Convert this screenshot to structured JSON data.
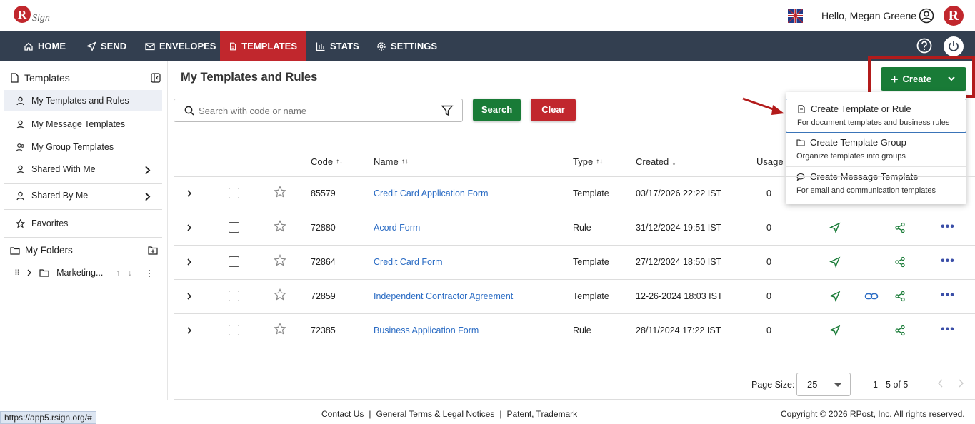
{
  "header": {
    "logo_text": "RSign",
    "greeting": "Hello, Megan Greene",
    "badge_letter": "R"
  },
  "nav": {
    "items": [
      {
        "label": "HOME",
        "icon": "home-icon"
      },
      {
        "label": "SEND",
        "icon": "send-icon"
      },
      {
        "label": "ENVELOPES",
        "icon": "envelope-icon"
      },
      {
        "label": "TEMPLATES",
        "icon": "template-icon",
        "active": true
      },
      {
        "label": "STATS",
        "icon": "stats-icon"
      },
      {
        "label": "SETTINGS",
        "icon": "gear-icon"
      }
    ]
  },
  "sidebar": {
    "title": "Templates",
    "items": [
      {
        "label": "My Templates and Rules",
        "active": true
      },
      {
        "label": "My Message Templates"
      },
      {
        "label": "My Group Templates"
      },
      {
        "label": "Shared With Me"
      },
      {
        "label": "Shared By Me"
      },
      {
        "label": "Favorites"
      }
    ],
    "folders_title": "My Folders",
    "folder": "Marketing..."
  },
  "main": {
    "title": "My Templates and Rules",
    "search": {
      "placeholder": "Search with code or name",
      "value": ""
    },
    "search_label": "Search",
    "clear_label": "Clear",
    "create_label": "Create"
  },
  "create_menu": [
    {
      "title": "Create Template or Rule",
      "sub": "For document templates and business rules"
    },
    {
      "title": "Create Template Group",
      "sub": "Organize templates into groups"
    },
    {
      "title": "Create Message Template",
      "sub": "For email and communication templates"
    }
  ],
  "table": {
    "columns": {
      "code": "Code",
      "name": "Name",
      "type": "Type",
      "created": "Created",
      "usage": "Usage"
    },
    "rows": [
      {
        "code": "85579",
        "name": "Credit Card Application Form",
        "type": "Template",
        "created": "03/17/2026 22:22 IST",
        "usage": "0"
      },
      {
        "code": "72880",
        "name": "Acord Form",
        "type": "Rule",
        "created": "31/12/2024 19:51 IST",
        "usage": "0"
      },
      {
        "code": "72864",
        "name": "Credit Card Form",
        "type": "Template",
        "created": "27/12/2024 18:50 IST",
        "usage": "0"
      },
      {
        "code": "72859",
        "name": "Independent Contractor Agreement",
        "type": "Template",
        "created": "12-26-2024 18:03 IST",
        "usage": "0"
      },
      {
        "code": "72385",
        "name": "Business Application Form",
        "type": "Rule",
        "created": "28/11/2024 17:22 IST",
        "usage": "0"
      }
    ]
  },
  "pager": {
    "label": "Page Size:",
    "size": "25",
    "range": "1 - 5 of 5"
  },
  "footer": {
    "contact": "Contact Us",
    "terms": "General Terms & Legal Notices",
    "patent": "Patent, Trademark",
    "copyright": "Copyright © 2026 RPost, Inc. All rights reserved."
  },
  "status_url": "https://app5.rsign.org/#",
  "colors": {
    "nav": "#333f50",
    "active": "#c1272d",
    "green": "#197b37",
    "link": "#2b6cc4"
  }
}
